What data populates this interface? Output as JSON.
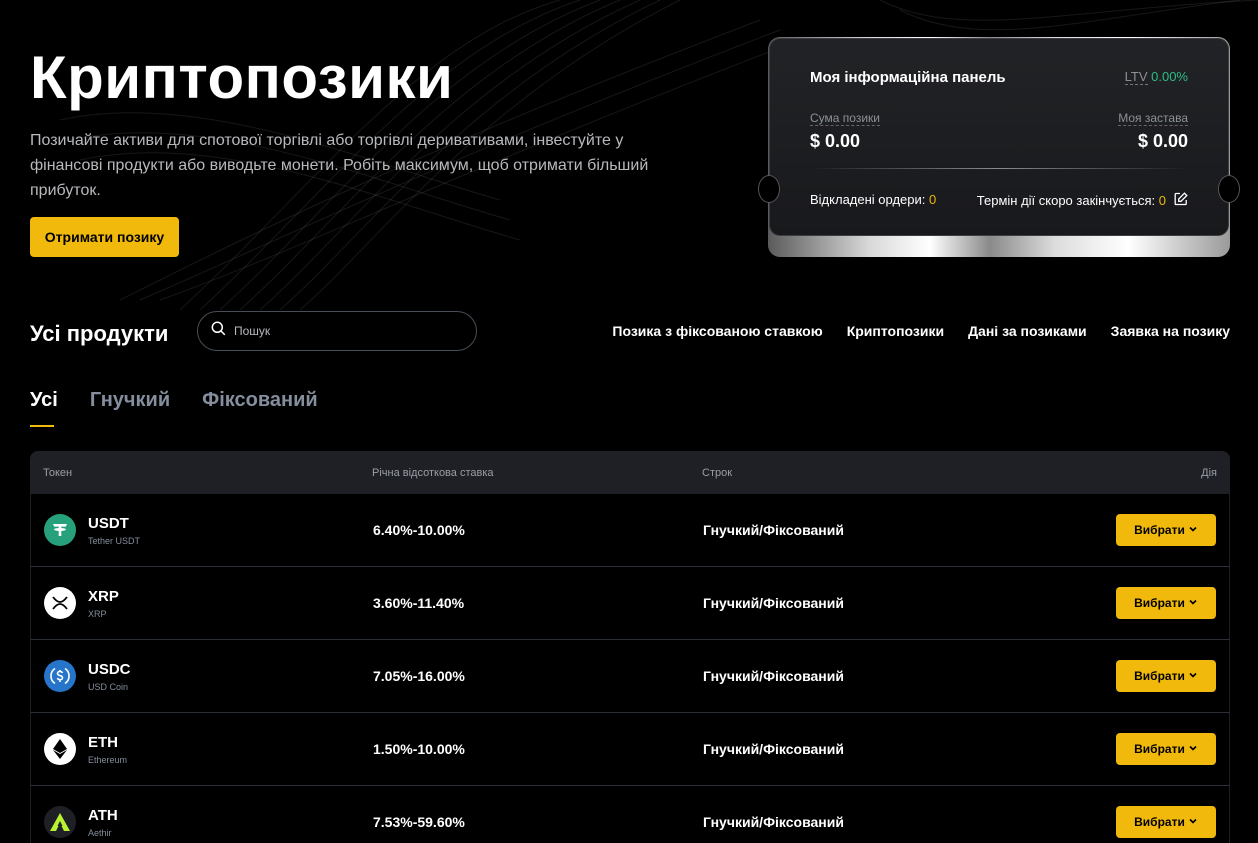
{
  "hero": {
    "title": "Криптопозики",
    "description": "Позичайте активи для спотової торгівлі або торгівлі деривативами, інвестуйте у фінансові продукти або виводьте монети. Робіть максимум, щоб отримати більший прибуток.",
    "cta_label": "Отримати позику"
  },
  "dashboard": {
    "title": "Моя інформаційна панель",
    "ltv_label": "LTV",
    "ltv_value": "0.00%",
    "loan_amount_label": "Сума позики",
    "loan_amount_value": "$ 0.00",
    "collateral_label": "Моя застава",
    "collateral_value": "$ 0.00",
    "pending_label": "Відкладені ордери:",
    "pending_value": "0",
    "expiring_label": "Термін дії скоро закінчується:",
    "expiring_value": "0"
  },
  "products": {
    "title": "Усі продукти",
    "search_placeholder": "Пошук",
    "links": [
      "Позика з фіксованою ставкою",
      "Криптопозики",
      "Дані за позиками",
      "Заявка на позику"
    ],
    "tabs": [
      "Усі",
      "Гнучкий",
      "Фіксований"
    ],
    "active_tab": "Усі"
  },
  "table": {
    "headers": [
      "Токен",
      "Річна відсоткова ставка",
      "Строк",
      "Дія"
    ],
    "action_label": "Вибрати",
    "rows": [
      {
        "symbol": "USDT",
        "name": "Tether USDT",
        "rate": "6.40%-10.00%",
        "term": "Гнучкий/Фіксований",
        "icon": "usdt-icon"
      },
      {
        "symbol": "XRP",
        "name": "XRP",
        "rate": "3.60%-11.40%",
        "term": "Гнучкий/Фіксований",
        "icon": "xrp-icon"
      },
      {
        "symbol": "USDC",
        "name": "USD Coin",
        "rate": "7.05%-16.00%",
        "term": "Гнучкий/Фіксований",
        "icon": "usdc-icon"
      },
      {
        "symbol": "ETH",
        "name": "Ethereum",
        "rate": "1.50%-10.00%",
        "term": "Гнучкий/Фіксований",
        "icon": "eth-icon"
      },
      {
        "symbol": "ATH",
        "name": "Aethir",
        "rate": "7.53%-59.60%",
        "term": "Гнучкий/Фіксований",
        "icon": "ath-icon"
      }
    ]
  },
  "colors": {
    "accent": "#f0b90b",
    "positive": "#2ebd85",
    "background": "#000000",
    "muted_text": "#848e9c"
  }
}
